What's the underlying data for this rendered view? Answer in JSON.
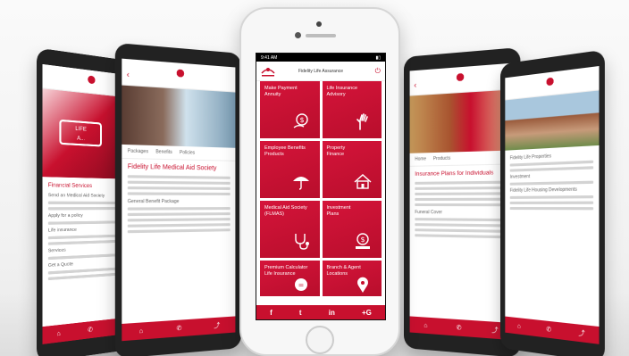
{
  "brand_color": "#c8102e",
  "center_phone": {
    "status_left": "9:41 AM",
    "header_title": "Fidelity Life Assurance",
    "tiles": [
      {
        "label": "Make Payment\nAnnuity",
        "icon": "money-hand-icon"
      },
      {
        "label": "Life Insurance\nAdvisory",
        "icon": "hand-icon"
      },
      {
        "label": "Employee Benefits\nProducts",
        "icon": "umbrella-icon"
      },
      {
        "label": "Property\nFinance",
        "icon": "house-icon"
      },
      {
        "label": "Medical Aid Society\n(FLMAS)",
        "icon": "stethoscope-icon"
      },
      {
        "label": "Investment\nPlans",
        "icon": "money-stack-icon"
      },
      {
        "label": "Premium Calculator\nLife Insurance",
        "icon": "calculator-icon"
      },
      {
        "label": "Branch & Agent\nLocations",
        "icon": "location-icon"
      }
    ],
    "social": [
      "f",
      "t",
      "in",
      "+G"
    ]
  },
  "left_phone": {
    "title": "Financial Services",
    "lines": [
      "Send an Medical Aid Society",
      "Apply for a policy",
      "Life insurance",
      "Services",
      "Get a Quote"
    ]
  },
  "left_mid_phone": {
    "tabs": [
      "Packages",
      "Benefits",
      "Policies"
    ],
    "title": "Fidelity Life Medical Aid Society",
    "section": "General Benefit Package"
  },
  "right_mid_phone": {
    "tabs": [
      "Home",
      "Products"
    ],
    "title": "Insurance Plans for Individuals",
    "section": "Funeral Cover"
  },
  "right_phone": {
    "lines": [
      "Fidelity Life Properties",
      "Investment",
      "Fidelity Life Housing Developments"
    ]
  }
}
